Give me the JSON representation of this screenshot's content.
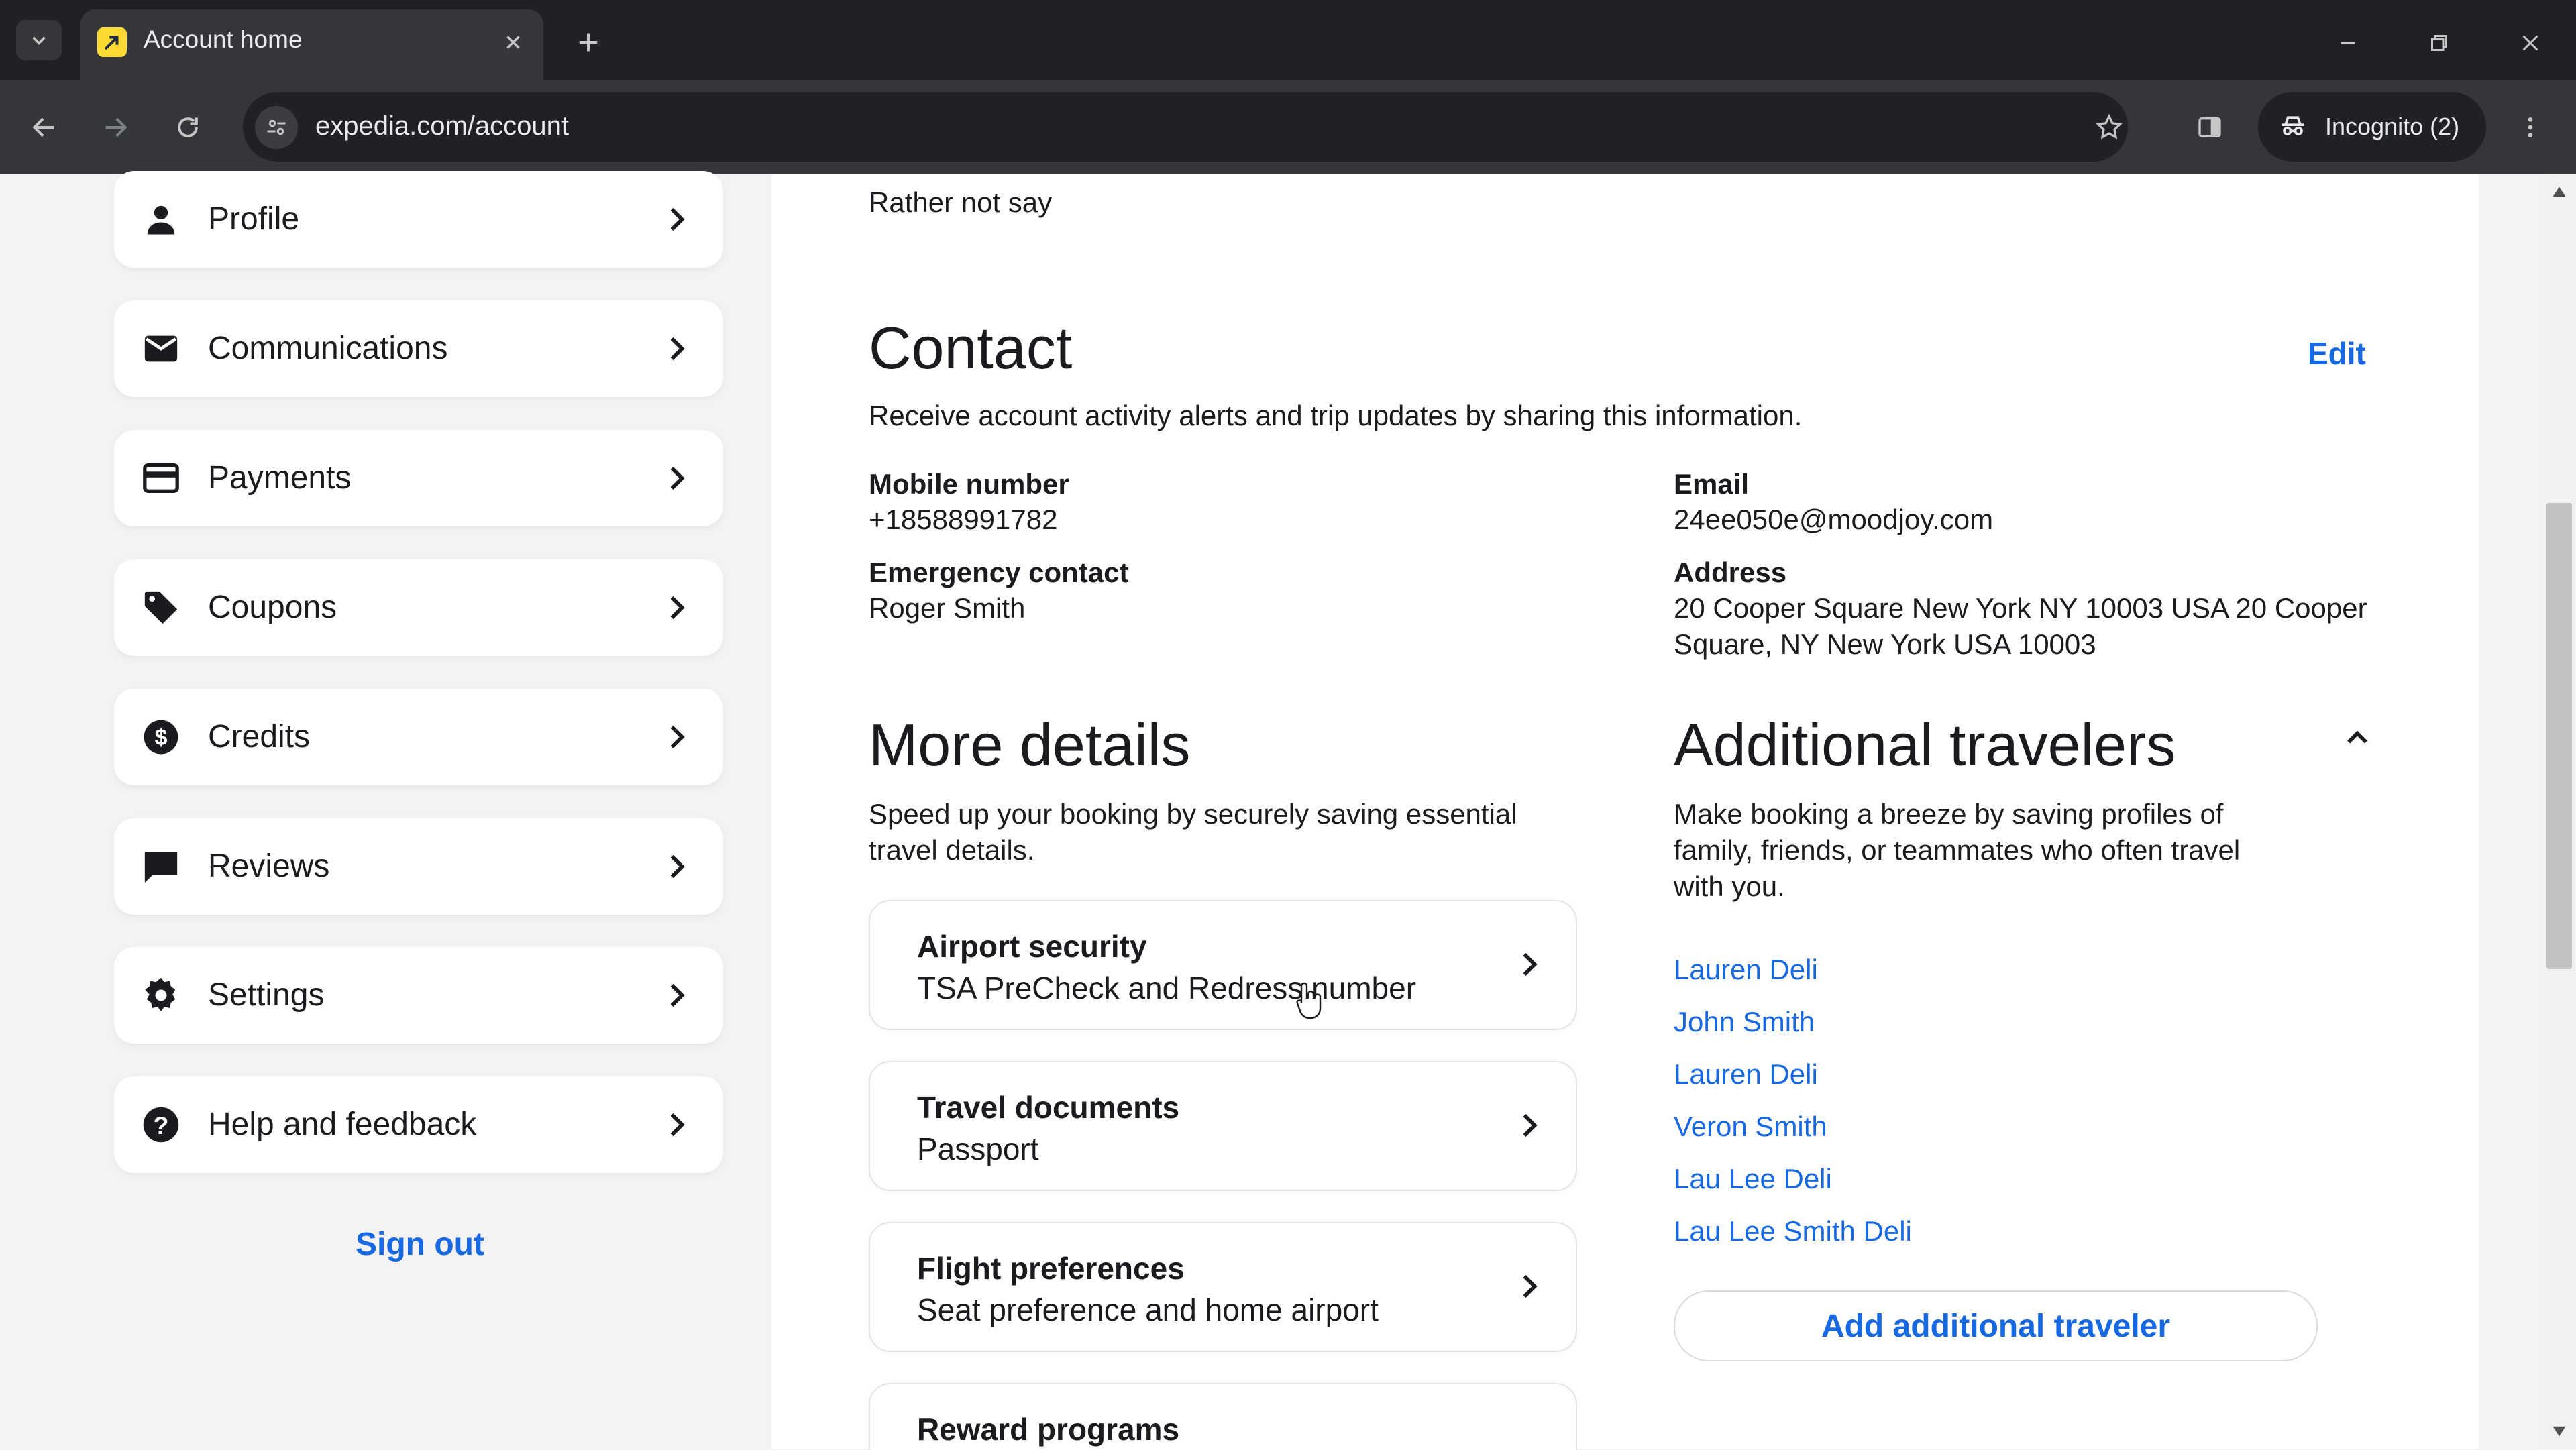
{
  "browser": {
    "tab_title": "Account home",
    "url": "expedia.com/account",
    "incognito_label": "Incognito (2)"
  },
  "sidebar": {
    "items": [
      {
        "label": "Profile",
        "icon": "person-icon"
      },
      {
        "label": "Communications",
        "icon": "mail-icon"
      },
      {
        "label": "Payments",
        "icon": "credit-card-icon"
      },
      {
        "label": "Coupons",
        "icon": "tag-icon"
      },
      {
        "label": "Credits",
        "icon": "dollar-coin-icon"
      },
      {
        "label": "Reviews",
        "icon": "chat-bubble-icon"
      },
      {
        "label": "Settings",
        "icon": "gear-icon"
      },
      {
        "label": "Help and feedback",
        "icon": "help-icon"
      }
    ],
    "sign_out": "Sign out"
  },
  "main": {
    "gender_value": "Rather not say",
    "contact": {
      "title": "Contact",
      "edit": "Edit",
      "description": "Receive account activity alerts and trip updates by sharing this information.",
      "mobile_label": "Mobile number",
      "mobile_value": "+18588991782",
      "email_label": "Email",
      "email_value": "24ee050e@moodjoy.com",
      "emergency_label": "Emergency contact",
      "emergency_value": "Roger Smith",
      "address_label": "Address",
      "address_line1": "20 Cooper Square New York NY 10003 USA 20 Cooper",
      "address_line2": "Square, NY New York USA 10003"
    },
    "more_details": {
      "title": "More details",
      "desc_line1": "Speed up your booking by securely saving essential",
      "desc_line2": "travel details.",
      "cards": [
        {
          "title": "Airport security",
          "subtitle": "TSA PreCheck and Redress number"
        },
        {
          "title": "Travel documents",
          "subtitle": "Passport"
        },
        {
          "title": "Flight preferences",
          "subtitle": "Seat preference and home airport"
        },
        {
          "title": "Reward programs",
          "subtitle": ""
        }
      ]
    },
    "additional_travelers": {
      "title": "Additional travelers",
      "desc_line1": "Make booking a breeze by saving profiles of",
      "desc_line2": "family, friends, or teammates who often travel",
      "desc_line3": "with you.",
      "travelers": [
        "Lauren Deli",
        "John Smith",
        "Lauren Deli",
        "Veron Smith",
        "Lau Lee Deli",
        "Lau Lee Smith Deli"
      ],
      "add_button": "Add additional traveler"
    }
  },
  "colors": {
    "link_blue": "#1668e3",
    "chrome_dark": "#202124",
    "chrome_toolbar": "#35363a",
    "sidebar_bg": "#f3f3f5"
  }
}
